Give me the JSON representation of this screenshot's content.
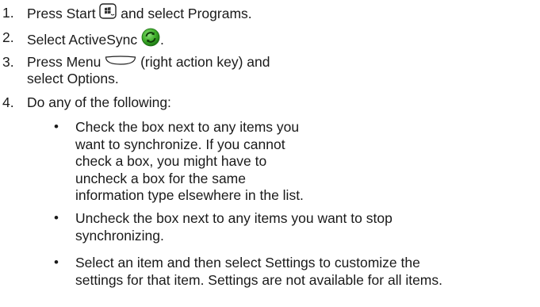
{
  "steps": [
    {
      "number": "1.",
      "before": "Press Start ",
      "start_icon": "windows-start-key-icon",
      "after": " and select Programs."
    },
    {
      "number": "2.",
      "before": "Select ActiveSync ",
      "sync_icon": "activesync-icon",
      "after": "."
    },
    {
      "number": "3.",
      "before": "Press Menu ",
      "menu_icon": "right-action-key-icon",
      "after": " (right action key) and",
      "line2": "select Options."
    },
    {
      "number": "4.",
      "text": "Do any of the following:"
    }
  ],
  "bullets": [
    {
      "symbol": "•",
      "lines": [
        "Check the box next to any items you",
        "want to synchronize. If you cannot",
        "check a box, you might have to",
        "uncheck a box for the same",
        "information type elsewhere in the list."
      ]
    },
    {
      "symbol": "•",
      "lines": [
        "Uncheck the box next to any items you want to stop",
        "synchronizing."
      ]
    },
    {
      "symbol": "•",
      "lines": [
        "Select an item and then select Settings to customize the",
        "settings for that item. Settings are not available for all items."
      ]
    }
  ],
  "colors": {
    "text": "#1a1a1a",
    "sync_green": "#3fae2a"
  }
}
